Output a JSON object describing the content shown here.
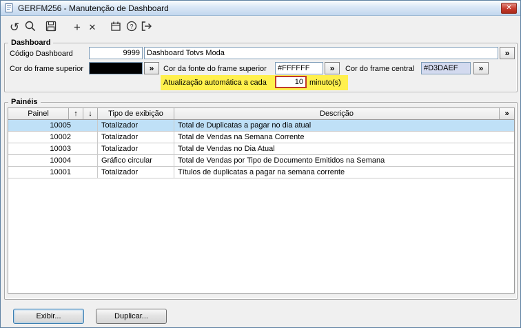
{
  "colors": {
    "selected_row": "#BFE0F7",
    "annotation_highlight": "#FFF04D",
    "annotation_border": "#C0392B",
    "frame_superior_swatch": "#000000",
    "frame_central_bg": "#D3DAEF"
  },
  "icons": {
    "close": "✕",
    "refresh": "↺",
    "add": "+",
    "delete": "✕",
    "sort_up": "↑",
    "sort_down": "↓",
    "expand": "»"
  },
  "window": {
    "title": "GERFM256 - Manutenção de Dashboard"
  },
  "toolbar": {
    "buttons": [
      "refresh",
      "search",
      "save",
      "add",
      "delete",
      "calendar",
      "help",
      "exit"
    ]
  },
  "dashboard": {
    "title": "Dashboard",
    "codigo_label": "Código Dashboard",
    "codigo_value": "9999",
    "nome_value": "Dashboard Totvs Moda",
    "cor_frame_superior_label": "Cor do frame superior",
    "cor_fonte_label": "Cor da fonte do frame superior",
    "cor_fonte_value": "#FFFFFF",
    "cor_central_label": "Cor do frame central",
    "cor_central_value": "#D3DAEF",
    "atualizacao_label": "Atualização automática a cada",
    "atualizacao_value": "10",
    "atualizacao_unit": "minuto(s)"
  },
  "paineis": {
    "title": "Painéis",
    "col_painel": "Painel",
    "col_tipo": "Tipo de exibição",
    "col_desc": "Descrição",
    "selected_row_index": 0,
    "rows": [
      {
        "painel": "10005",
        "tipo": "Totalizador",
        "descricao": "Total de Duplicatas a pagar no dia atual"
      },
      {
        "painel": "10002",
        "tipo": "Totalizador",
        "descricao": "Total de Vendas na Semana Corrente"
      },
      {
        "painel": "10003",
        "tipo": "Totalizador",
        "descricao": "Total de Vendas no Dia Atual"
      },
      {
        "painel": "10004",
        "tipo": "Gráfico circular",
        "descricao": "Total de Vendas por Tipo de Documento Emitidos na Semana"
      },
      {
        "painel": "10001",
        "tipo": "Totalizador",
        "descricao": "Títulos de duplicatas a pagar na semana corrente"
      }
    ]
  },
  "footer": {
    "exibir": "Exibir...",
    "duplicar": "Duplicar..."
  }
}
